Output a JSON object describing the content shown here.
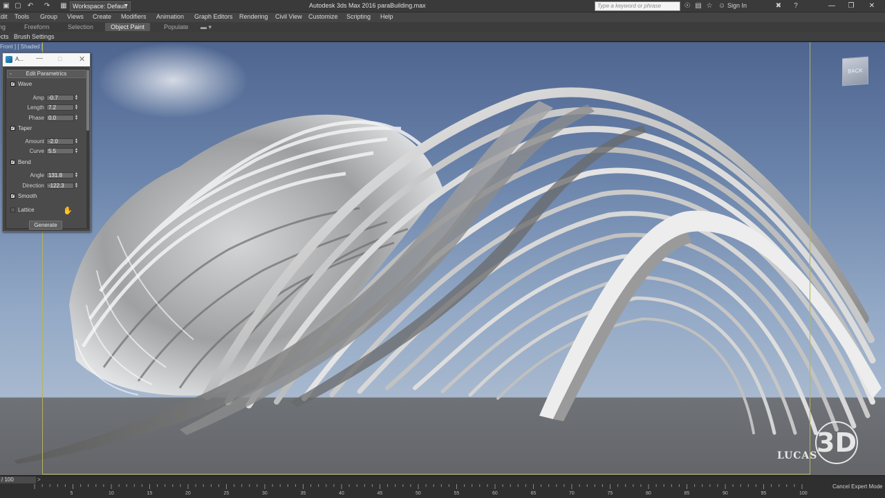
{
  "titlebar": {
    "workspace": "Workspace: Default",
    "app_title": "Autodesk 3ds Max 2016    paraBuilding.max",
    "search_placeholder": "Type a keyword or phrase",
    "sign_in": "Sign In"
  },
  "menu": [
    "Edit",
    "Tools",
    "Group",
    "Views",
    "Create",
    "Modifiers",
    "Animation",
    "Graph Editors",
    "Rendering",
    "Civil View",
    "Customize",
    "Scripting",
    "Help"
  ],
  "ribbon": {
    "tabs": [
      "ling",
      "Freeform",
      "Selection",
      "Object Paint",
      "Populate"
    ],
    "active_tab": "Object Paint",
    "row2": [
      "ects",
      "Brush Settings"
    ]
  },
  "viewport": {
    "label": "Front ] [ Shaded ]",
    "viewcube_label": "BACK",
    "watermark": "LUCAS",
    "watermark_mark": "3D"
  },
  "panel": {
    "title": "A...",
    "rollout": "Edit Parametrics",
    "groups": [
      {
        "label": "Wave",
        "checked": true,
        "fields": [
          {
            "label": "Amp",
            "value": "-0.7"
          },
          {
            "label": "Length",
            "value": "7.2"
          },
          {
            "label": "Phase",
            "value": "0.0"
          }
        ]
      },
      {
        "label": "Taper",
        "checked": true,
        "fields": [
          {
            "label": "Amount",
            "value": "-2.0"
          },
          {
            "label": "Curve",
            "value": "5.5"
          }
        ]
      },
      {
        "label": "Bend",
        "checked": true,
        "fields": [
          {
            "label": "Angle",
            "value": "131.8"
          },
          {
            "label": "Direction",
            "value": "-122.3"
          }
        ]
      }
    ],
    "smooth_label": "Smooth",
    "smooth_checked": true,
    "lattice_label": "Lattice",
    "lattice_checked": false,
    "generate_label": "Generate"
  },
  "timeline": {
    "frame": "/ 100",
    "ticks": [
      "5",
      "10",
      "15",
      "20",
      "25",
      "30",
      "35",
      "40",
      "45",
      "50",
      "55",
      "60",
      "65",
      "70",
      "75",
      "80",
      "85",
      "90",
      "95",
      "100"
    ],
    "status": "Cancel Expert Mode"
  },
  "colors": {
    "sky_top": "#4e6590",
    "sky_bottom": "#a8b9cf",
    "ground": "#666869",
    "safe_frame": "#b7b35a",
    "panel_bg": "#4b4b4b"
  }
}
